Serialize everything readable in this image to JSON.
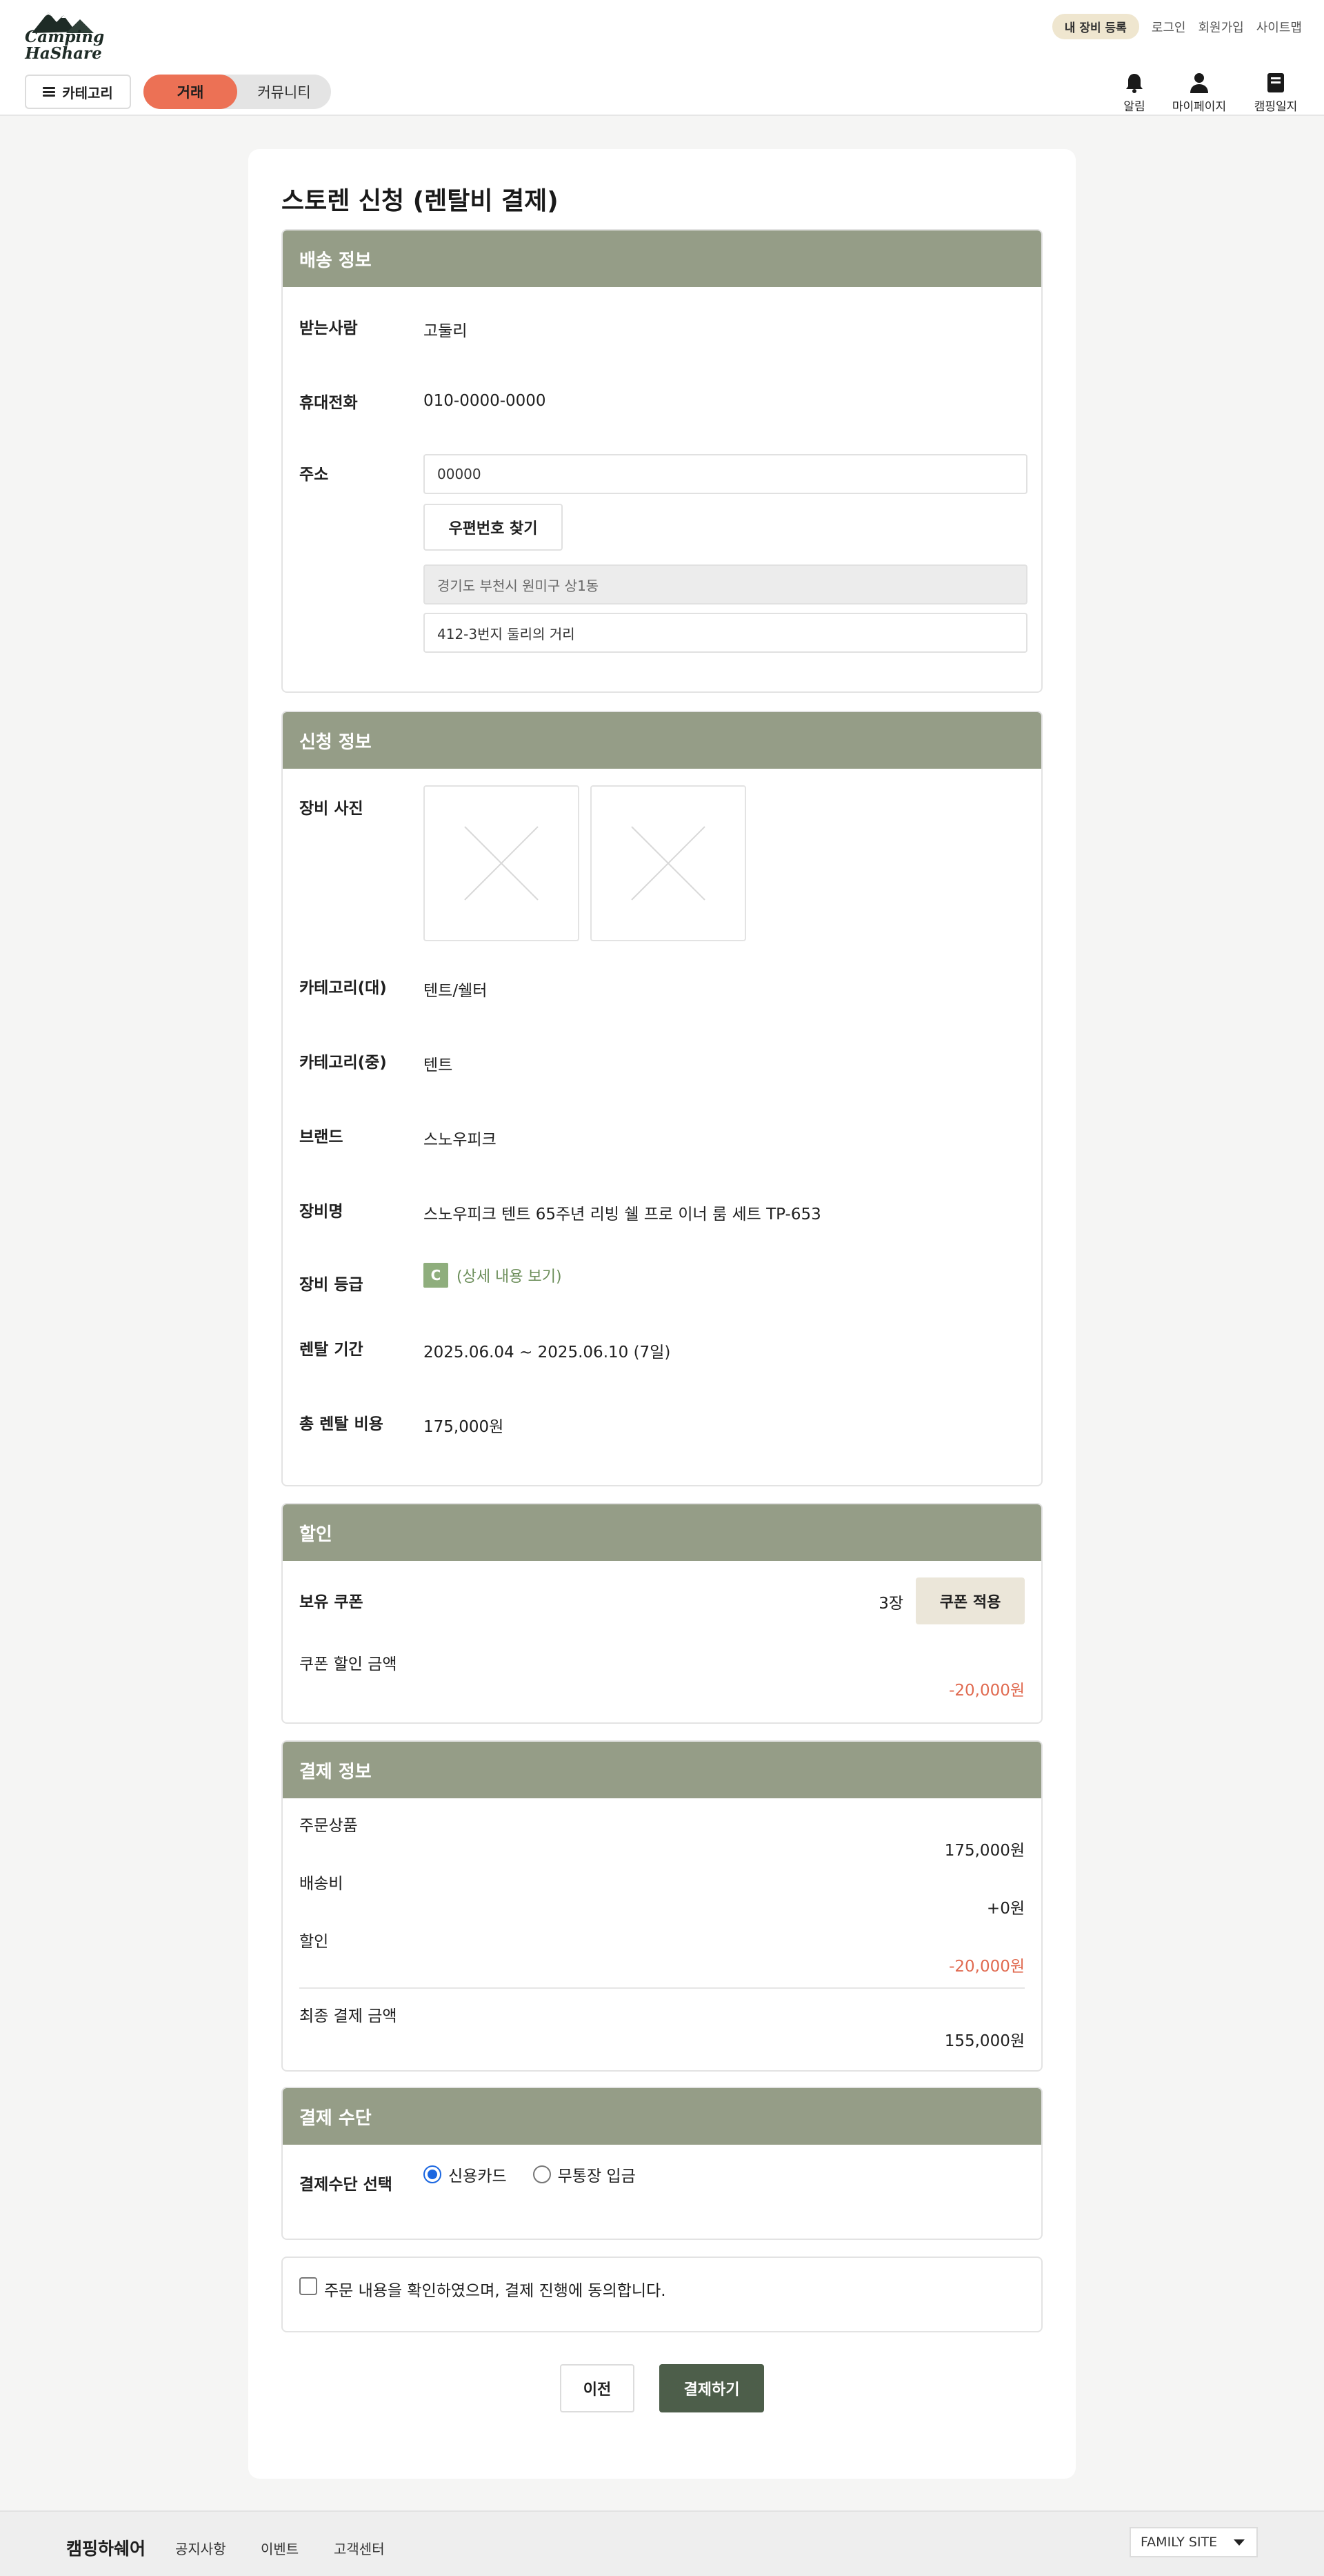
{
  "header": {
    "logo_text_1": "Camping",
    "logo_text_2": "HaShare",
    "register_btn": "내 장비 등록",
    "login": "로그인",
    "signup": "회원가입",
    "sitemap": "사이트맵",
    "category_btn": "카테고리",
    "tab_trade": "거래",
    "tab_community": "커뮤니티",
    "icon_alarm": "알림",
    "icon_mypage": "마이페이지",
    "icon_diary": "캠핑일지"
  },
  "page_title": "스토렌 신청 (렌탈비 결제)",
  "shipping": {
    "heading": "배송 정보",
    "recipient_label": "받는사람",
    "recipient_value": "고둘리",
    "phone_label": "휴대전화",
    "phone_value": "010-0000-0000",
    "address_label": "주소",
    "zipcode_value": "00000",
    "zip_search_btn": "우편번호 찾기",
    "address_main": "경기도 부천시 원미구 상1동",
    "address_detail": "412-3번지 둘리의 거리"
  },
  "application": {
    "heading": "신청 정보",
    "photo_label": "장비 사진",
    "cat_large_label": "카테고리(대)",
    "cat_large_value": "텐트/쉘터",
    "cat_mid_label": "카테고리(중)",
    "cat_mid_value": "텐트",
    "brand_label": "브랜드",
    "brand_value": "스노우피크",
    "name_label": "장비명",
    "name_value": "스노우피크 텐트 65주년 리빙 쉘 프로 이너 룸 세트 TP-653",
    "grade_label": "장비 등급",
    "grade_value": "C",
    "grade_link": "(상세 내용 보기)",
    "period_label": "렌탈 기간",
    "period_value": "2025.06.04 ~ 2025.06.10 (7일)",
    "cost_label": "총 렌탈 비용",
    "cost_value": "175,000원"
  },
  "discount": {
    "heading": "할인",
    "coupon_label": "보유 쿠폰",
    "coupon_count": "3장",
    "coupon_btn": "쿠폰 적용",
    "coupon_amount_label": "쿠폰 할인 금액",
    "coupon_amount_value": "-20,000원"
  },
  "payment_info": {
    "heading": "결제 정보",
    "order_label": "주문상품",
    "order_value": "175,000원",
    "shipping_label": "배송비",
    "shipping_value": "+0원",
    "discount_label": "할인",
    "discount_value": "-20,000원",
    "final_label": "최종 결제 금액",
    "final_value": "155,000원"
  },
  "payment_method": {
    "heading": "결제 수단",
    "label": "결제수단 선택",
    "option_card": "신용카드",
    "option_bank": "무통장 입금",
    "selected": "신용카드"
  },
  "agreement": {
    "text": "주문 내용을 확인하였으며, 결제 진행에 동의합니다.",
    "checked": false
  },
  "actions": {
    "prev": "이전",
    "pay": "결제하기"
  },
  "footer": {
    "brand": "캠핑하쉐어",
    "notice": "공지사항",
    "event": "이벤트",
    "support": "고객센터",
    "family_site": "FAMILY SITE"
  },
  "colors": {
    "section_header": "#959d87",
    "accent_tab": "#ec7155",
    "pay_button": "#4d5e4a",
    "negative": "#e06a50",
    "grade_badge": "#8fae7d"
  }
}
